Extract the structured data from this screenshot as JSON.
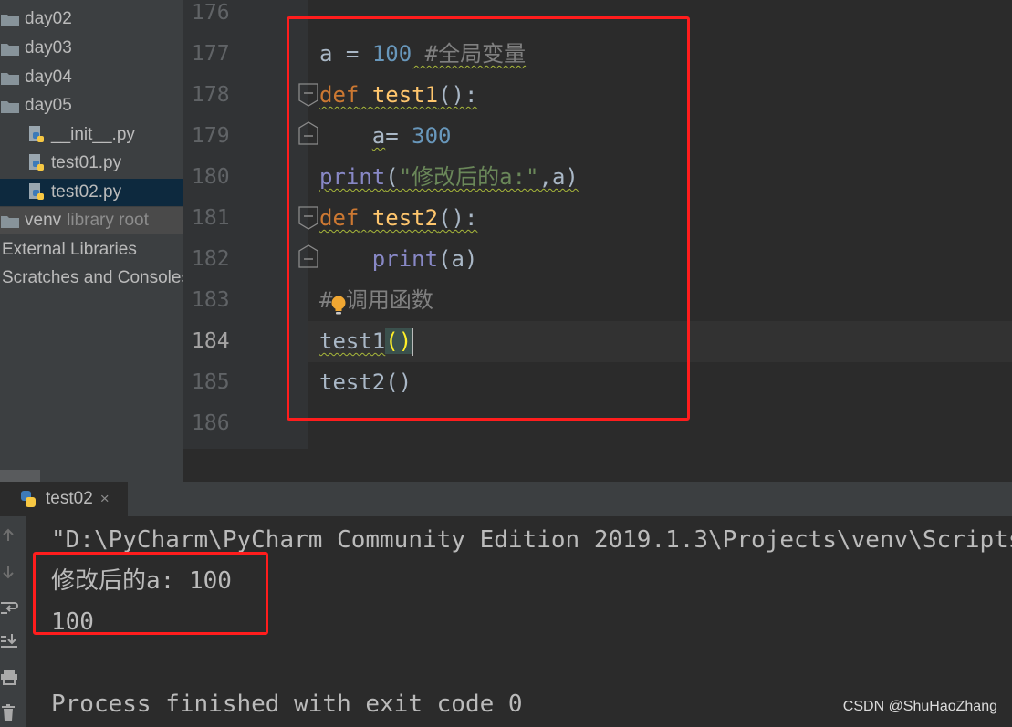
{
  "sidebar": {
    "items": [
      {
        "label": "day02",
        "type": "folder"
      },
      {
        "label": "day03",
        "type": "folder"
      },
      {
        "label": "day04",
        "type": "folder"
      },
      {
        "label": "day05",
        "type": "folder"
      },
      {
        "label": "__init__.py",
        "type": "python-file"
      },
      {
        "label": "test01.py",
        "type": "python-file"
      },
      {
        "label": "test02.py",
        "type": "python-file",
        "selected": true
      },
      {
        "label": "venv",
        "note": "library root",
        "type": "folder"
      },
      {
        "label": "External Libraries",
        "type": "section"
      },
      {
        "label": "Scratches and Consoles",
        "type": "section"
      }
    ]
  },
  "editor": {
    "line_numbers": [
      "176",
      "177",
      "178",
      "179",
      "180",
      "181",
      "182",
      "183",
      "184",
      "185",
      "186"
    ],
    "current_line": "184",
    "tokens": {
      "l177_var": "a",
      "l177_eq": " = ",
      "l177_num": "100",
      "l177_comment": " #全局变量",
      "l178_kw": "def",
      "l178_name": "test1",
      "l178_tail": "():",
      "l179_var": "a",
      "l179_eq": "= ",
      "l179_num": "300",
      "l180_print": "print",
      "l180_open": "(",
      "l180_str": "\"修改后的a:\"",
      "l180_rest": ",a)",
      "l181_kw": "def",
      "l181_name": "test2",
      "l181_tail": "():",
      "l182_print": "print",
      "l182_rest": "(a)",
      "l183_hash": "#",
      "l183_comment": "调用函数",
      "l184_name": "test1",
      "l184_open": "(",
      "l184_close": ")",
      "l185_code": "test2()"
    }
  },
  "run_panel": {
    "tab_label": "test02",
    "close_symbol": "×",
    "console_lines": [
      "\"D:\\PyCharm\\PyCharm Community Edition 2019.1.3\\Projects\\venv\\Scripts\\py",
      "修改后的a: 100",
      "100",
      "",
      "Process finished with exit code 0"
    ]
  },
  "watermark": "CSDN @ShuHaoZhang",
  "icons": [
    "folder-icon",
    "python-file-icon",
    "fold-marker-icon",
    "intention-bulb-icon",
    "arrow-up-icon",
    "arrow-down-icon",
    "soft-wrap-icon",
    "scroll-to-end-icon",
    "print-icon",
    "trash-icon"
  ],
  "colors": {
    "annotation_red": "#ff1d1d",
    "keyword": "#cc7832",
    "function": "#ffc66d",
    "number": "#6897bb",
    "string": "#6a8759",
    "builtin": "#8888c6"
  }
}
